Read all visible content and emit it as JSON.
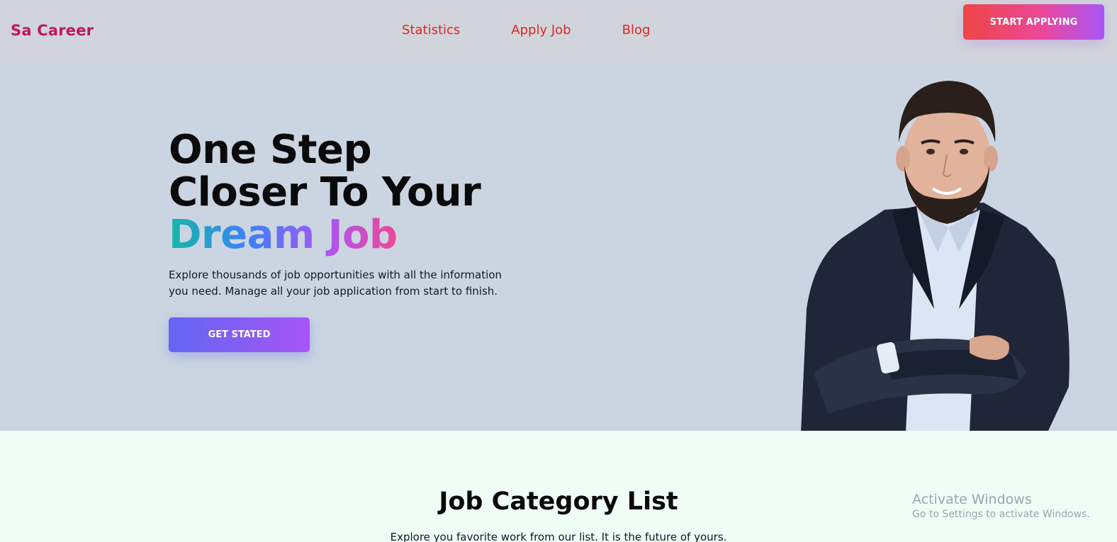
{
  "header": {
    "brand": "Sa Career",
    "nav": [
      {
        "label": "Statistics"
      },
      {
        "label": "Apply Job"
      },
      {
        "label": "Blog"
      }
    ],
    "cta_label": "START APPLYING"
  },
  "hero": {
    "title_line1": "One Step",
    "title_line2": "Closer To Your",
    "title_highlight": "Dream Job",
    "description": "Explore thousands of job opportunities with all the information you need. Manage all your job application from start to finish.",
    "cta_label": "GET STATED"
  },
  "categories": {
    "title": "Job Category List",
    "subtitle": "Explore you favorite work from our list. It is the future of yours."
  },
  "watermark": {
    "title": "Activate Windows",
    "subtitle": "Go to Settings to activate Windows."
  },
  "colors": {
    "brand": "#be185d",
    "nav_link": "#dc2626",
    "header_bg": "#d1d5db",
    "hero_bg": "#cbd5e1",
    "section_bg": "#f0fdf4"
  }
}
